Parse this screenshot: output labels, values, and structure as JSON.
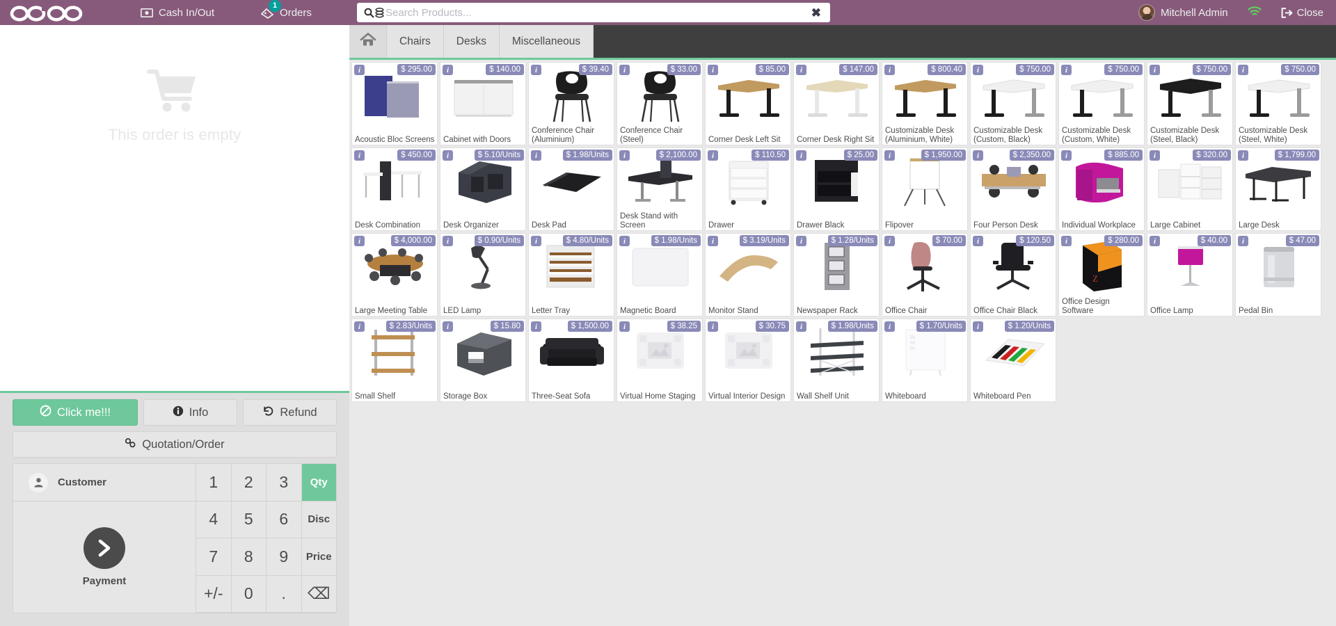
{
  "topbar": {
    "logo": "odoo",
    "cash_in_out": "Cash In/Out",
    "orders": "Orders",
    "orders_badge": "1",
    "user": "Mitchell Admin",
    "close": "Close",
    "icons": {
      "cash": "money-bill-icon",
      "orders": "ticket-icon",
      "wifi": "wifi-icon",
      "close": "sign-out-icon"
    }
  },
  "search": {
    "placeholder": "Search Products...",
    "value": "",
    "clear": "✖"
  },
  "order": {
    "empty_text": "This order is empty"
  },
  "buttons": {
    "click_me": "Click me!!!",
    "info": "Info",
    "refund": "Refund",
    "quotation_order": "Quotation/Order"
  },
  "numpad": {
    "customer": "Customer",
    "payment": "Payment",
    "keys": [
      {
        "label": "1",
        "type": "digit"
      },
      {
        "label": "2",
        "type": "digit"
      },
      {
        "label": "3",
        "type": "digit"
      },
      {
        "label": "Qty",
        "type": "mode",
        "active": true
      },
      {
        "label": "4",
        "type": "digit"
      },
      {
        "label": "5",
        "type": "digit"
      },
      {
        "label": "6",
        "type": "digit"
      },
      {
        "label": "Disc",
        "type": "mode",
        "active": false
      },
      {
        "label": "7",
        "type": "digit"
      },
      {
        "label": "8",
        "type": "digit"
      },
      {
        "label": "9",
        "type": "digit"
      },
      {
        "label": "Price",
        "type": "mode",
        "active": false
      },
      {
        "label": "+/-",
        "type": "digit"
      },
      {
        "label": "0",
        "type": "digit"
      },
      {
        "label": ".",
        "type": "digit"
      },
      {
        "label": "⌫",
        "type": "backspace"
      }
    ]
  },
  "categories": {
    "home_icon": "home-icon",
    "tabs": [
      "Chairs",
      "Desks",
      "Miscellaneous"
    ]
  },
  "colors": {
    "brand": "#875a7b",
    "accent_green": "#6ec89b",
    "price_tag": "#8a8ab8",
    "badge_teal": "#00a09d"
  },
  "products": [
    {
      "name": "Acoustic Bloc Screens",
      "price": "$ 295.00",
      "art": "screen-blue"
    },
    {
      "name": "Cabinet with Doors",
      "price": "$ 140.00",
      "art": "cabinet-white"
    },
    {
      "name": "Conference Chair (Aluminium)",
      "price": "$ 39.40",
      "art": "chair-black"
    },
    {
      "name": "Conference Chair (Steel)",
      "price": "$ 33.00",
      "art": "chair-black"
    },
    {
      "name": "Corner Desk Left Sit",
      "price": "$ 85.00",
      "art": "desk-wood-black"
    },
    {
      "name": "Corner Desk Right Sit",
      "price": "$ 147.00",
      "art": "desk-beige-white"
    },
    {
      "name": "Customizable Desk (Aluminium, White)",
      "price": "$ 800.40",
      "art": "desk-wood-black"
    },
    {
      "name": "Customizable Desk (Custom, Black)",
      "price": "$ 750.00",
      "art": "desk-white-black"
    },
    {
      "name": "Customizable Desk (Custom, White)",
      "price": "$ 750.00",
      "art": "desk-white-black"
    },
    {
      "name": "Customizable Desk (Steel, Black)",
      "price": "$ 750.00",
      "art": "desk-black-top"
    },
    {
      "name": "Customizable Desk (Steel, White)",
      "price": "$ 750.00",
      "art": "desk-white-black"
    },
    {
      "name": "Desk Combination",
      "price": "$ 450.00",
      "art": "desk-combo"
    },
    {
      "name": "Desk Organizer",
      "price": "$ 5.10/Units",
      "art": "organizer"
    },
    {
      "name": "Desk Pad",
      "price": "$ 1.98/Units",
      "art": "pad"
    },
    {
      "name": "Desk Stand with Screen",
      "price": "$ 2,100.00",
      "art": "desk-stand"
    },
    {
      "name": "Drawer",
      "price": "$ 110.50",
      "art": "drawer-white"
    },
    {
      "name": "Drawer Black",
      "price": "$ 25.00",
      "art": "drawer-black"
    },
    {
      "name": "Flipover",
      "price": "$ 1,950.00",
      "art": "flipover"
    },
    {
      "name": "Four Person Desk",
      "price": "$ 2,350.00",
      "art": "four-desk"
    },
    {
      "name": "Individual Workplace",
      "price": "$ 885.00",
      "art": "workplace-magenta"
    },
    {
      "name": "Large Cabinet",
      "price": "$ 320.00",
      "art": "large-cabinet"
    },
    {
      "name": "Large Desk",
      "price": "$ 1,799.00",
      "art": "large-desk"
    },
    {
      "name": "Large Meeting Table",
      "price": "$ 4,000.00",
      "art": "meeting-table"
    },
    {
      "name": "LED Lamp",
      "price": "$ 0.90/Units",
      "art": "led-lamp"
    },
    {
      "name": "Letter Tray",
      "price": "$ 4.80/Units",
      "art": "letter-tray"
    },
    {
      "name": "Magnetic Board",
      "price": "$ 1.98/Units",
      "art": "magnetic-board"
    },
    {
      "name": "Monitor Stand",
      "price": "$ 3.19/Units",
      "art": "monitor-stand"
    },
    {
      "name": "Newspaper Rack",
      "price": "$ 1.28/Units",
      "art": "news-rack"
    },
    {
      "name": "Office Chair",
      "price": "$ 70.00",
      "art": "office-chair-pink"
    },
    {
      "name": "Office Chair Black",
      "price": "$ 120.50",
      "art": "office-chair-black"
    },
    {
      "name": "Office Design Software",
      "price": "$ 280.00",
      "art": "software-box"
    },
    {
      "name": "Office Lamp",
      "price": "$ 40.00",
      "art": "office-lamp"
    },
    {
      "name": "Pedal Bin",
      "price": "$ 47.00",
      "art": "pedal-bin"
    },
    {
      "name": "Small Shelf",
      "price": "$ 2.83/Units",
      "art": "small-shelf"
    },
    {
      "name": "Storage Box",
      "price": "$ 15.80",
      "art": "storage-box"
    },
    {
      "name": "Three-Seat Sofa",
      "price": "$ 1,500.00",
      "art": "sofa"
    },
    {
      "name": "Virtual Home Staging",
      "price": "$ 38.25",
      "art": "placeholder"
    },
    {
      "name": "Virtual Interior Design",
      "price": "$ 30.75",
      "art": "placeholder"
    },
    {
      "name": "Wall Shelf Unit",
      "price": "$ 1.98/Units",
      "art": "wall-shelf"
    },
    {
      "name": "Whiteboard",
      "price": "$ 1.70/Units",
      "art": "whiteboard"
    },
    {
      "name": "Whiteboard Pen",
      "price": "$ 1.20/Units",
      "art": "whiteboard-pen"
    }
  ]
}
